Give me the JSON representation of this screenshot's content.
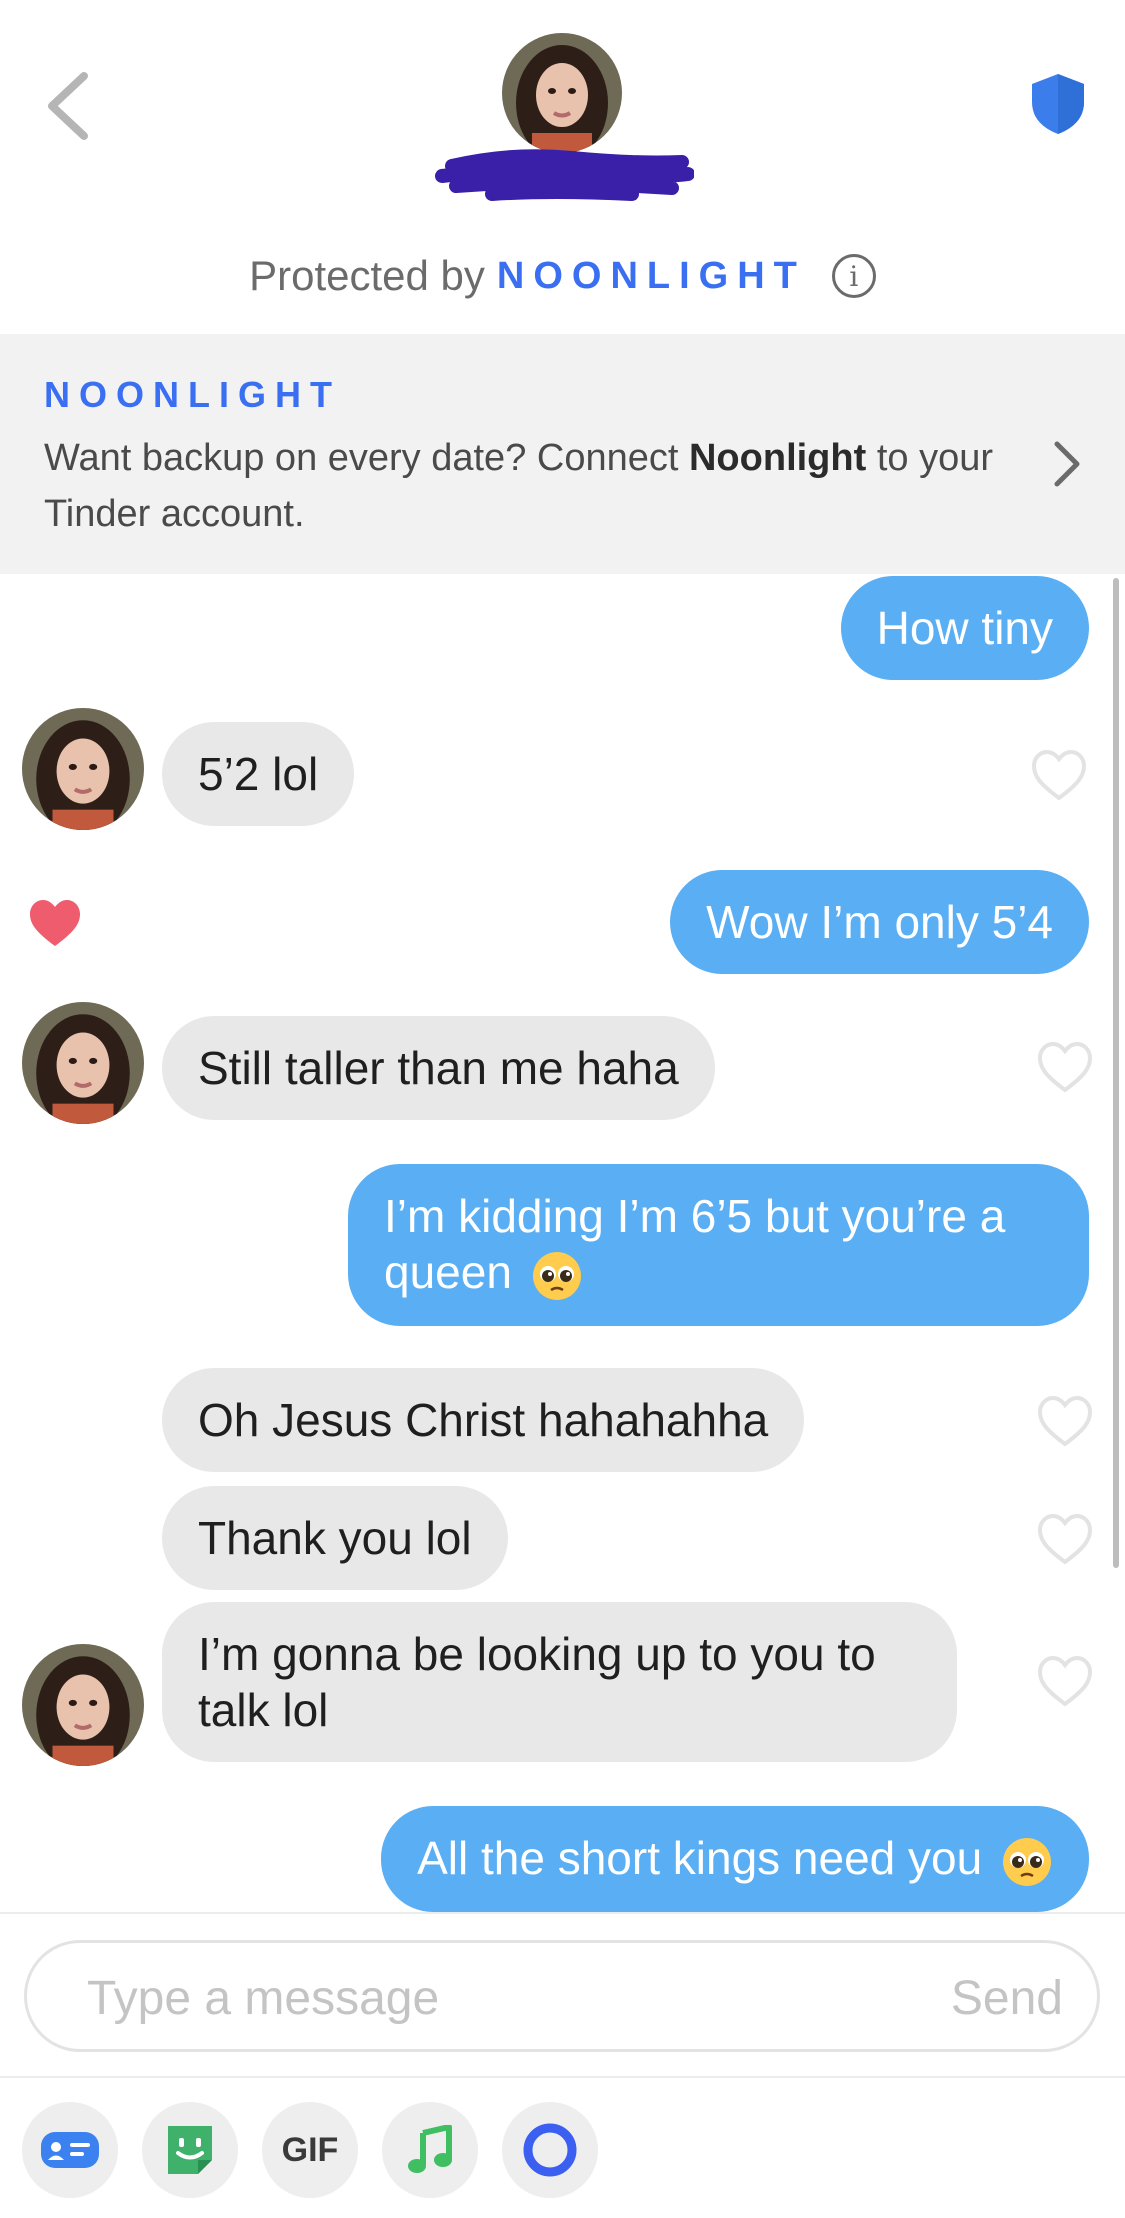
{
  "header": {
    "protected_prefix": "Protected by",
    "protected_brand": "NOONLIGHT",
    "info_glyph": "i",
    "shield_color": "#3b7dea",
    "icons": [
      "back-chevron-icon",
      "shield-icon",
      "info-icon"
    ]
  },
  "banner": {
    "brand": "NOONLIGHT",
    "text_before": "Want backup on every date? Connect",
    "text_bold": "Noonlight",
    "text_after": "to your Tinder account."
  },
  "messages": [
    {
      "from": "me",
      "text": "How tiny"
    },
    {
      "from": "them",
      "text": "5’2 lol",
      "liked": false
    },
    {
      "from": "me",
      "text": "Wow I’m only 5’4",
      "liked": true
    },
    {
      "from": "them",
      "text": "Still taller than me haha",
      "liked": false
    },
    {
      "from": "me",
      "text": "I’m kidding I’m 6’5 but you’re a queen",
      "emoji": "pleading-face"
    },
    {
      "from": "them",
      "text": "Oh Jesus Christ hahahahha",
      "liked": false
    },
    {
      "from": "them",
      "text": "Thank you lol",
      "liked": false
    },
    {
      "from": "them",
      "text": "I’m gonna be looking up to you to talk lol",
      "liked": false
    },
    {
      "from": "me",
      "text": "All the short kings need you",
      "emoji": "pleading-face"
    }
  ],
  "composer": {
    "placeholder": "Type a message",
    "send_label": "Send"
  },
  "toolbar": {
    "gif_label": "GIF",
    "buttons": [
      "contact-card-icon",
      "sticker-icon",
      "gif-button",
      "music-note-icon",
      "loop-icon"
    ]
  },
  "colors": {
    "outgoing_bubble": "#5aaef4",
    "incoming_bubble": "#e8e8e8",
    "brand_blue": "#3b6ff2",
    "liked_heart": "#ee5c6e"
  }
}
